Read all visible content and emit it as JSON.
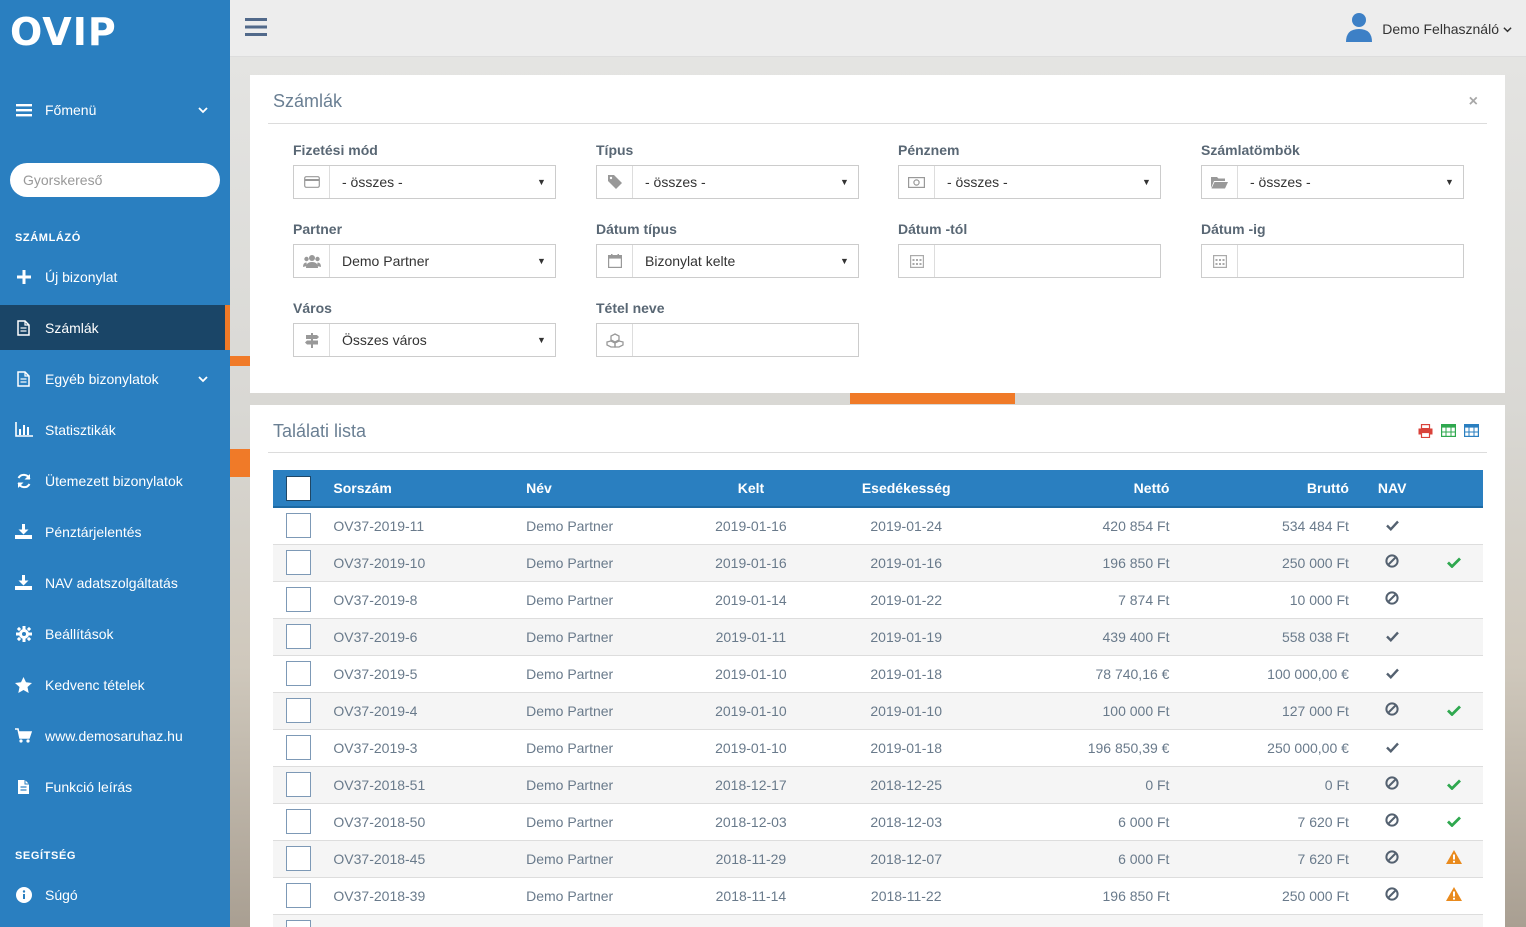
{
  "sidebar": {
    "logo": "OVIP",
    "fomenu": "Főmenü",
    "search_placeholder": "Gyorskereső",
    "section_szamlazo": "SZÁMLÁZÓ",
    "items": [
      {
        "label": "Új bizonylat",
        "icon": "plus-icon"
      },
      {
        "label": "Számlák",
        "icon": "file-icon",
        "active": true
      },
      {
        "label": "Egyéb bizonylatok",
        "icon": "file-icon"
      },
      {
        "label": "Statisztikák",
        "icon": "bar-chart-icon"
      },
      {
        "label": "Ütemezett bizonylatok",
        "icon": "refresh-icon"
      },
      {
        "label": "Pénztárjelentés",
        "icon": "download-icon"
      },
      {
        "label": "NAV adatszolgáltatás",
        "icon": "download-icon"
      },
      {
        "label": "Beállítások",
        "icon": "gear-icon"
      },
      {
        "label": "Kedvenc tételek",
        "icon": "star-icon"
      },
      {
        "label": "www.demosaruhaz.hu",
        "icon": "cart-icon"
      },
      {
        "label": "Funkció leírás",
        "icon": "file-icon"
      }
    ],
    "section_segitseg": "SEGÍTSÉG",
    "help": "Súgó"
  },
  "topbar": {
    "user_name": "Demo Felhasználó"
  },
  "filters": {
    "title": "Számlák",
    "fizetesi_mod_label": "Fizetési mód",
    "fizetesi_mod_value": "- összes -",
    "tipus_label": "Típus",
    "tipus_value": "- összes -",
    "penznem_label": "Pénznem",
    "penznem_value": "- összes -",
    "szamlatombok_label": "Számlatömbök",
    "szamlatombok_value": "- összes -",
    "partner_label": "Partner",
    "partner_value": "Demo Partner",
    "datum_tipus_label": "Dátum típus",
    "datum_tipus_value": "Bizonylat kelte",
    "datum_tol_label": "Dátum -tól",
    "datum_tol_value": "",
    "datum_ig_label": "Dátum -ig",
    "datum_ig_value": "",
    "varos_label": "Város",
    "varos_value": "Összes város",
    "tetel_neve_label": "Tétel neve",
    "tetel_neve_value": ""
  },
  "results": {
    "title": "Találati lista",
    "columns": [
      "Sorszám",
      "Név",
      "Kelt",
      "Esedékesség",
      "Nettó",
      "Bruttó",
      "NAV"
    ],
    "rows": [
      {
        "sorszam": "OV37-2019-11",
        "nev": "Demo Partner",
        "kelt": "2019-01-16",
        "esed": "2019-01-24",
        "netto": "420 854 Ft",
        "brutto": "534 484 Ft",
        "nav": "check",
        "status": ""
      },
      {
        "sorszam": "OV37-2019-10",
        "nev": "Demo Partner",
        "kelt": "2019-01-16",
        "esed": "2019-01-16",
        "netto": "196 850 Ft",
        "brutto": "250 000 Ft",
        "nav": "ban",
        "status": "ok"
      },
      {
        "sorszam": "OV37-2019-8",
        "nev": "Demo Partner",
        "kelt": "2019-01-14",
        "esed": "2019-01-22",
        "netto": "7 874 Ft",
        "brutto": "10 000 Ft",
        "nav": "ban",
        "status": ""
      },
      {
        "sorszam": "OV37-2019-6",
        "nev": "Demo Partner",
        "kelt": "2019-01-11",
        "esed": "2019-01-19",
        "netto": "439 400 Ft",
        "brutto": "558 038 Ft",
        "nav": "check",
        "status": ""
      },
      {
        "sorszam": "OV37-2019-5",
        "nev": "Demo Partner",
        "kelt": "2019-01-10",
        "esed": "2019-01-18",
        "netto": "78 740,16 €",
        "brutto": "100 000,00 €",
        "nav": "check",
        "status": ""
      },
      {
        "sorszam": "OV37-2019-4",
        "nev": "Demo Partner",
        "kelt": "2019-01-10",
        "esed": "2019-01-10",
        "netto": "100 000 Ft",
        "brutto": "127 000 Ft",
        "nav": "ban",
        "status": "ok"
      },
      {
        "sorszam": "OV37-2019-3",
        "nev": "Demo Partner",
        "kelt": "2019-01-10",
        "esed": "2019-01-18",
        "netto": "196 850,39 €",
        "brutto": "250 000,00 €",
        "nav": "check",
        "status": ""
      },
      {
        "sorszam": "OV37-2018-51",
        "nev": "Demo Partner",
        "kelt": "2018-12-17",
        "esed": "2018-12-25",
        "netto": "0 Ft",
        "brutto": "0 Ft",
        "nav": "ban",
        "status": "ok"
      },
      {
        "sorszam": "OV37-2018-50",
        "nev": "Demo Partner",
        "kelt": "2018-12-03",
        "esed": "2018-12-03",
        "netto": "6 000 Ft",
        "brutto": "7 620 Ft",
        "nav": "ban",
        "status": "ok"
      },
      {
        "sorszam": "OV37-2018-45",
        "nev": "Demo Partner",
        "kelt": "2018-11-29",
        "esed": "2018-12-07",
        "netto": "6 000 Ft",
        "brutto": "7 620 Ft",
        "nav": "ban",
        "status": "warn"
      },
      {
        "sorszam": "OV37-2018-39",
        "nev": "Demo Partner",
        "kelt": "2018-11-14",
        "esed": "2018-11-22",
        "netto": "196 850 Ft",
        "brutto": "250 000 Ft",
        "nav": "ban",
        "status": "warn"
      }
    ]
  },
  "colors": {
    "sidebar": "#2a7fc0",
    "sidebar_active": "#1a4567",
    "accent": "#f07a28",
    "ok": "#2fa84f",
    "warn": "#e98a1d"
  }
}
